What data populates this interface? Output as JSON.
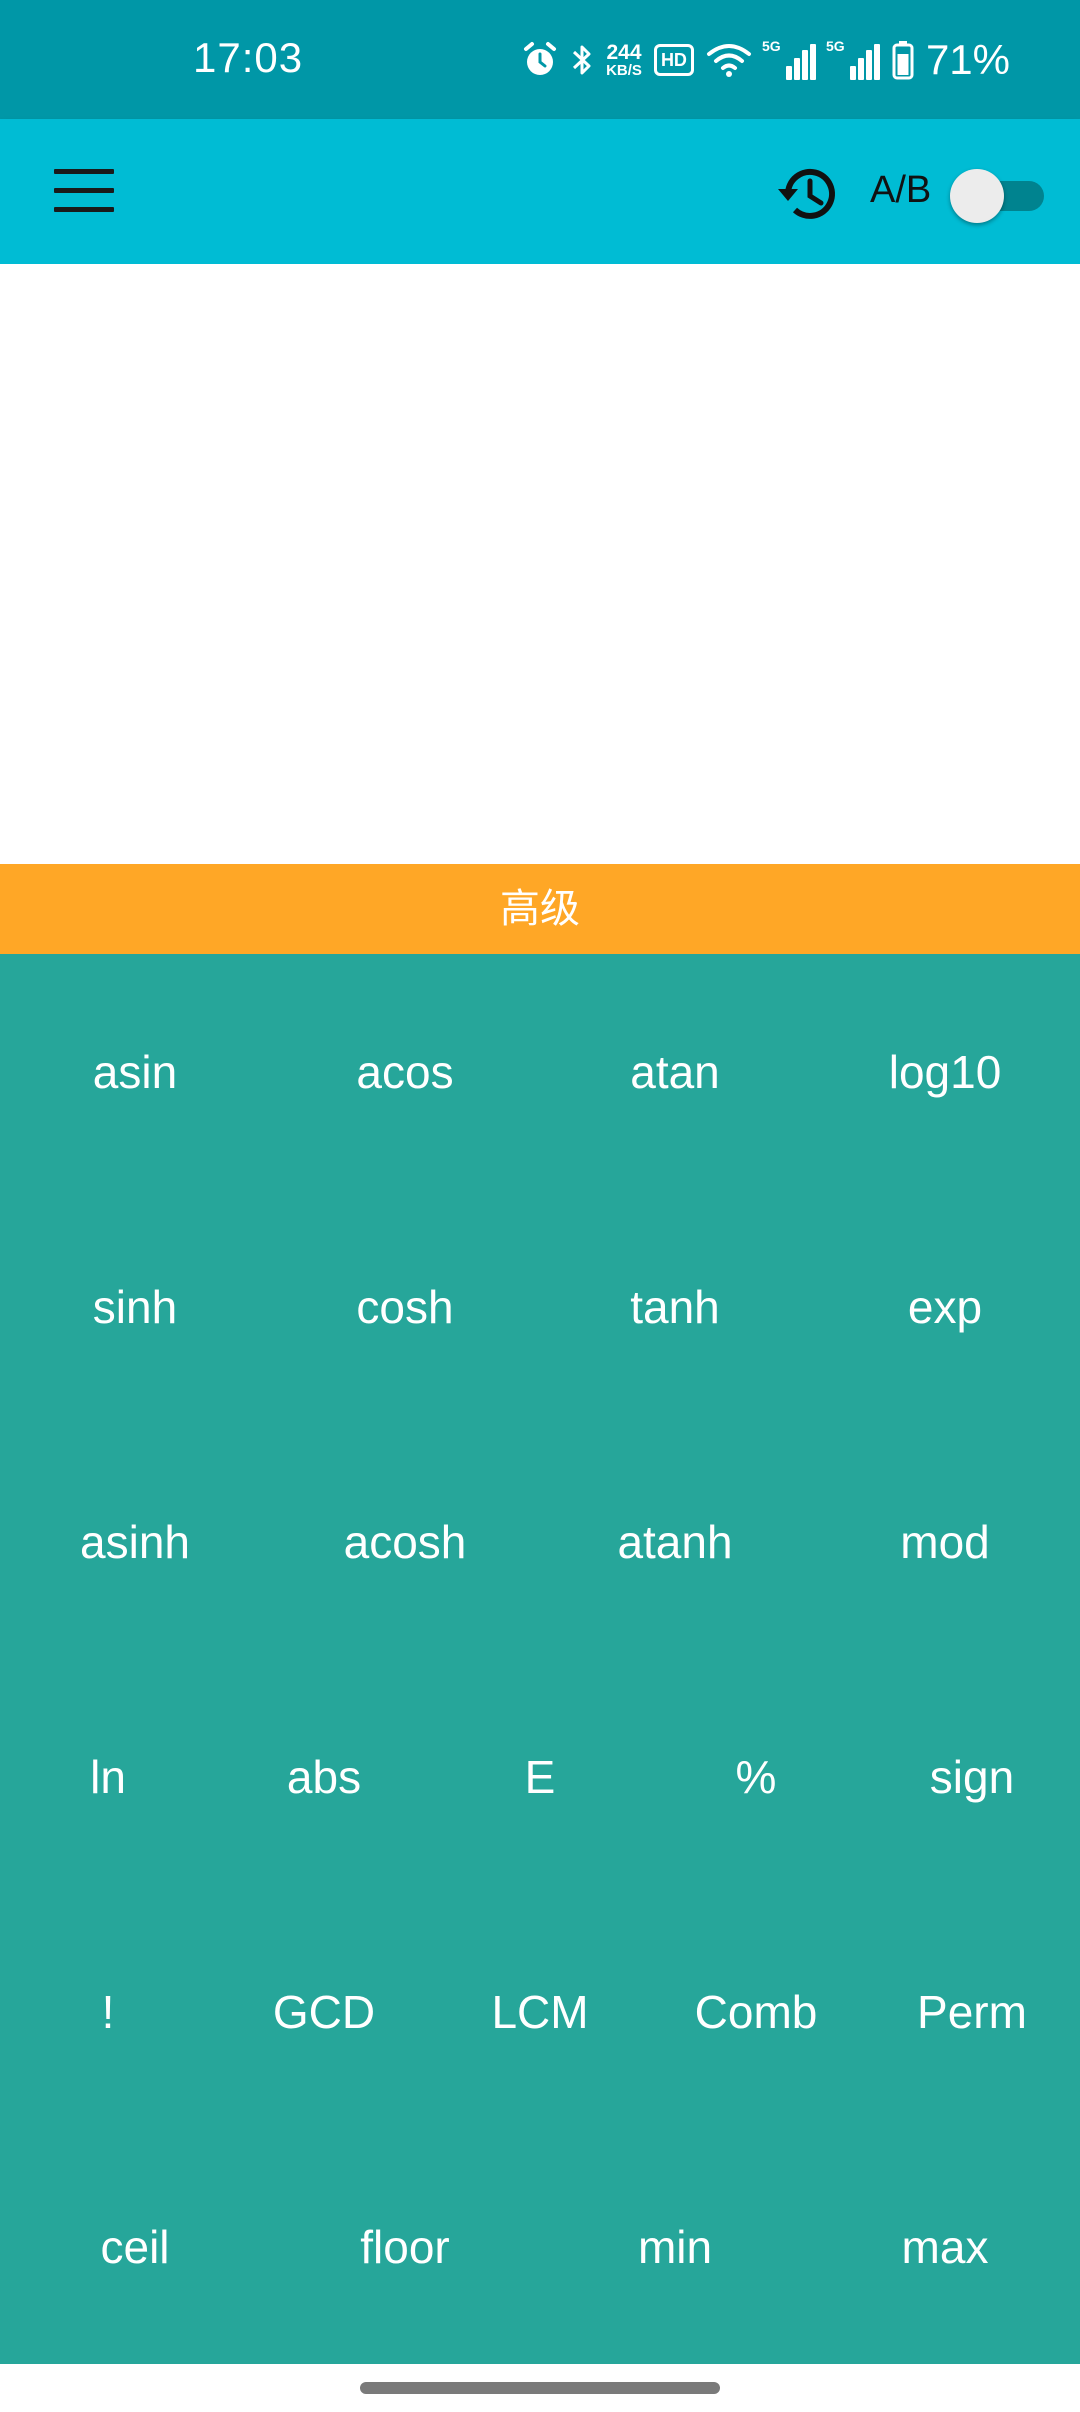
{
  "status_bar": {
    "time": "17:03",
    "net_speed_value": "244",
    "net_speed_unit": "KB/S",
    "hd_label": "HD",
    "signal1_label": "5G",
    "signal2_label": "5G",
    "battery_percent": "71%",
    "icons": [
      "alarm-icon",
      "bluetooth-icon",
      "wifi-icon",
      "signal-icon",
      "signal-icon",
      "battery-icon"
    ]
  },
  "toolbar": {
    "ab_label": "A/B",
    "ab_switch_on": false,
    "icons": [
      "menu-icon",
      "history-icon"
    ]
  },
  "advanced_bar": {
    "label": "高级"
  },
  "keypad": {
    "rows": [
      [
        "asin",
        "acos",
        "atan",
        "log10"
      ],
      [
        "sinh",
        "cosh",
        "tanh",
        "exp"
      ],
      [
        "asinh",
        "acosh",
        "atanh",
        "mod"
      ],
      [
        "ln",
        "abs",
        "E",
        "%",
        "sign"
      ],
      [
        "!",
        "GCD",
        "LCM",
        "Comb",
        "Perm"
      ],
      [
        "ceil",
        "floor",
        "min",
        "max"
      ]
    ]
  },
  "colors": {
    "status_bar": "#0097A7",
    "toolbar": "#00BCD4",
    "advanced_bar": "#FFA726",
    "keypad": "#26A69A",
    "switch_track": "#00838F"
  }
}
